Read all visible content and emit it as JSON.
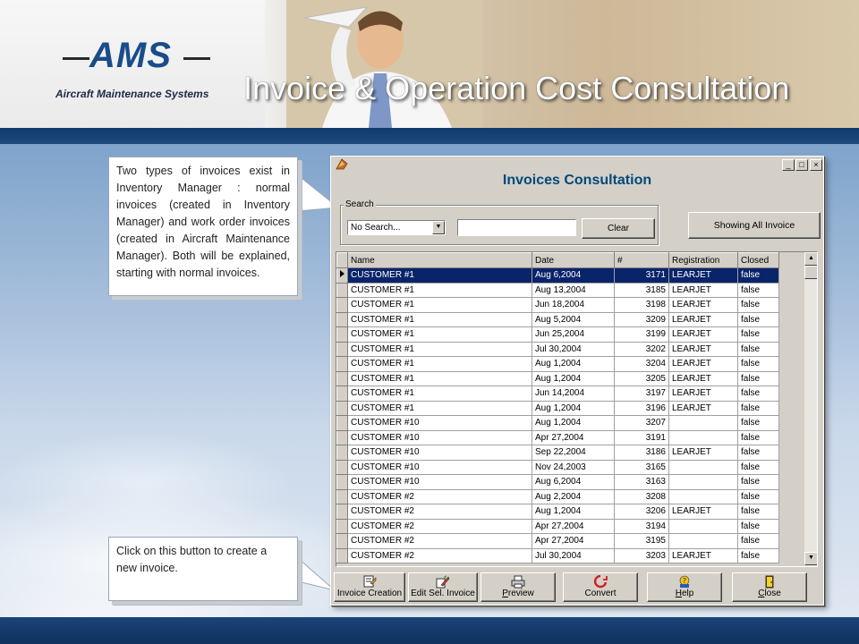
{
  "header": {
    "logo_text": "AMS",
    "logo_sub": "Aircraft Maintenance Systems",
    "slide_title": "Invoice & Operation Cost Consultation"
  },
  "callouts": {
    "first": "Two types of invoices exist in Inventory Manager : normal invoices (created in Inventory Manager) and work order invoices (created in Aircraft Maintenance Manager). Both will be explained, starting with normal invoices.",
    "second": "Click on this button to create a new invoice."
  },
  "window": {
    "title": "Invoices Consultation",
    "controls": {
      "minimize": "_",
      "maximize": "□",
      "close": "×"
    },
    "search": {
      "group_label": "Search",
      "mode_value": "No Search...",
      "text_value": "",
      "clear_label": "Clear"
    },
    "show_all_label": "Showing All Invoice",
    "grid": {
      "columns": [
        "Name",
        "Date",
        "#",
        "Registration",
        "Closed"
      ],
      "selected_row": 0,
      "rows": [
        [
          "CUSTOMER #1",
          "Aug 6,2004",
          "3171",
          "LEARJET",
          "false"
        ],
        [
          "CUSTOMER #1",
          "Aug 13,2004",
          "3185",
          "LEARJET",
          "false"
        ],
        [
          "CUSTOMER #1",
          "Jun 18,2004",
          "3198",
          "LEARJET",
          "false"
        ],
        [
          "CUSTOMER #1",
          "Aug 5,2004",
          "3209",
          "LEARJET",
          "false"
        ],
        [
          "CUSTOMER #1",
          "Jun 25,2004",
          "3199",
          "LEARJET",
          "false"
        ],
        [
          "CUSTOMER #1",
          "Jul 30,2004",
          "3202",
          "LEARJET",
          "false"
        ],
        [
          "CUSTOMER #1",
          "Aug 1,2004",
          "3204",
          "LEARJET",
          "false"
        ],
        [
          "CUSTOMER #1",
          "Aug 1,2004",
          "3205",
          "LEARJET",
          "false"
        ],
        [
          "CUSTOMER #1",
          "Jun 14,2004",
          "3197",
          "LEARJET",
          "false"
        ],
        [
          "CUSTOMER #1",
          "Aug 1,2004",
          "3196",
          "LEARJET",
          "false"
        ],
        [
          "CUSTOMER #10",
          "Aug 1,2004",
          "3207",
          "",
          "false"
        ],
        [
          "CUSTOMER #10",
          "Apr 27,2004",
          "3191",
          "",
          "false"
        ],
        [
          "CUSTOMER #10",
          "Sep 22,2004",
          "3186",
          "LEARJET",
          "false"
        ],
        [
          "CUSTOMER #10",
          "Nov 24,2003",
          "3165",
          "",
          "false"
        ],
        [
          "CUSTOMER #10",
          "Aug 6,2004",
          "3163",
          "",
          "false"
        ],
        [
          "CUSTOMER #2",
          "Aug 2,2004",
          "3208",
          "",
          "false"
        ],
        [
          "CUSTOMER #2",
          "Aug 1,2004",
          "3206",
          "LEARJET",
          "false"
        ],
        [
          "CUSTOMER #2",
          "Apr 27,2004",
          "3194",
          "",
          "false"
        ],
        [
          "CUSTOMER #2",
          "Apr 27,2004",
          "3195",
          "",
          "false"
        ],
        [
          "CUSTOMER #2",
          "Jul 30,2004",
          "3203",
          "LEARJET",
          "false"
        ]
      ]
    },
    "toolbar": [
      {
        "name": "invoice-creation-button",
        "icon": "invoice-creation-icon",
        "label": "Invoice Creation",
        "underline": false
      },
      {
        "name": "edit-selected-invoice-button",
        "icon": "edit-pencil-icon",
        "label": "Edit Sel. Invoice",
        "underline": false
      },
      {
        "name": "preview-button",
        "icon": "printer-icon",
        "label": "Preview",
        "underline": true
      },
      {
        "name": "convert-button",
        "icon": "convert-icon",
        "label": "Convert",
        "underline": false
      },
      {
        "name": "help-button",
        "icon": "help-icon",
        "label": "Help",
        "underline": true
      },
      {
        "name": "close-button",
        "icon": "door-exit-icon",
        "label": "Close",
        "underline": true
      }
    ]
  },
  "colors": {
    "selection": "#0a246a",
    "window_face": "#d4d0c8",
    "title_blue": "#00497a",
    "header_bar": "#123a6b"
  }
}
